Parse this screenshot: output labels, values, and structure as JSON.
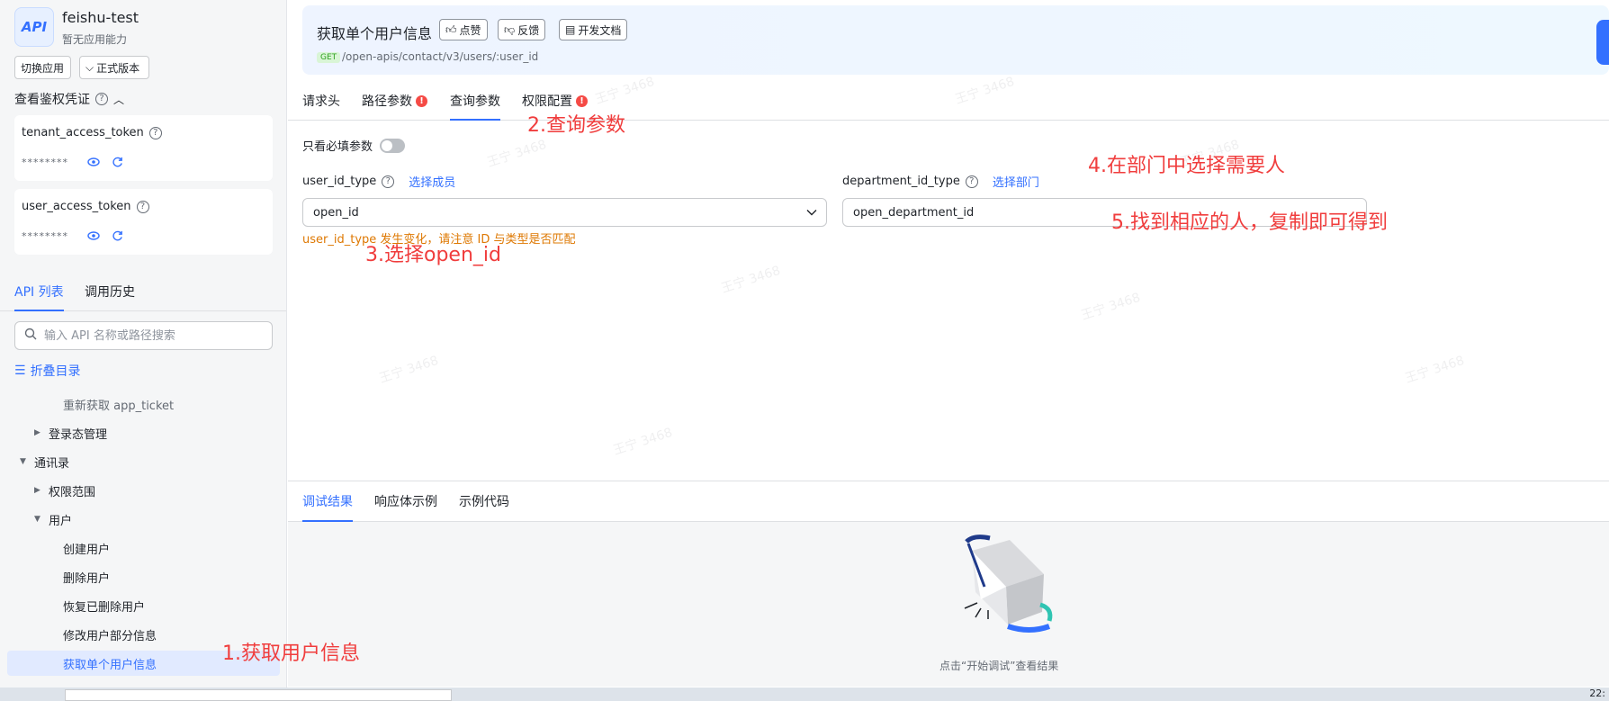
{
  "app": {
    "logo": "API",
    "name": "feishu-test",
    "subtitle": "暂无应用能力",
    "switch_label": "切换应用",
    "version_label": "正式版本"
  },
  "credentials": {
    "title": "查看鉴权凭证",
    "tenant_token_name": "tenant_access_token",
    "tenant_token_mask": "********",
    "user_token_name": "user_access_token",
    "user_token_mask": "********"
  },
  "sidebar": {
    "tabs": [
      "API 列表",
      "调用历史"
    ],
    "search_placeholder": "输入 API 名称或路径搜索",
    "fold_label": "折叠目录",
    "tree": [
      {
        "label": "重新获取 app_ticket"
      },
      {
        "label": "登录态管理"
      },
      {
        "label": "通讯录"
      },
      {
        "label": "权限范围"
      },
      {
        "label": "用户"
      },
      {
        "label": "创建用户"
      },
      {
        "label": "删除用户"
      },
      {
        "label": "恢复已删除用户"
      },
      {
        "label": "修改用户部分信息"
      },
      {
        "label": "获取单个用户信息"
      }
    ]
  },
  "header": {
    "title": "获取单个用户信息",
    "like_label": "点赞",
    "feedback_label": "反馈",
    "docs_label": "开发文档",
    "method": "GET",
    "path": "/open-apis/contact/v3/users/:user_id"
  },
  "tabs": [
    "请求头",
    "路径参数",
    "查询参数",
    "权限配置"
  ],
  "query": {
    "required_only_label": "只看必填参数",
    "user_id_type_label": "user_id_type",
    "user_id_type_link": "选择成员",
    "user_id_type_value": "open_id",
    "department_id_type_label": "department_id_type",
    "department_id_type_link": "选择部门",
    "department_id_type_value": "open_department_id",
    "warning": "user_id_type 发生变化，请注意 ID 与类型是否匹配"
  },
  "result": {
    "tabs": [
      "调试结果",
      "响应体示例",
      "示例代码"
    ],
    "empty_hint": "点击“开始调试”查看结果"
  },
  "annotations": {
    "a1": "1.获取用户信息",
    "a2": "2.查询参数",
    "a3": "3.选择open_id",
    "a4": "4.在部门中选择需要人",
    "a5": "5.找到相应的人，复制即可得到"
  },
  "taskbar": {
    "time": "22:"
  },
  "watermark": "王宁 3468",
  "colors": {
    "accent": "#3370ff",
    "annotation": "#f03d3d",
    "warning": "#de7802",
    "error": "#f54a45"
  },
  "icons": [
    "help-icon",
    "eye-icon",
    "refresh-icon",
    "search-icon",
    "list-icon",
    "thumbs-up-icon",
    "thumbs-down-icon",
    "doc-icon",
    "chevron-down-icon",
    "alert-icon",
    "empty-box-illustration"
  ]
}
